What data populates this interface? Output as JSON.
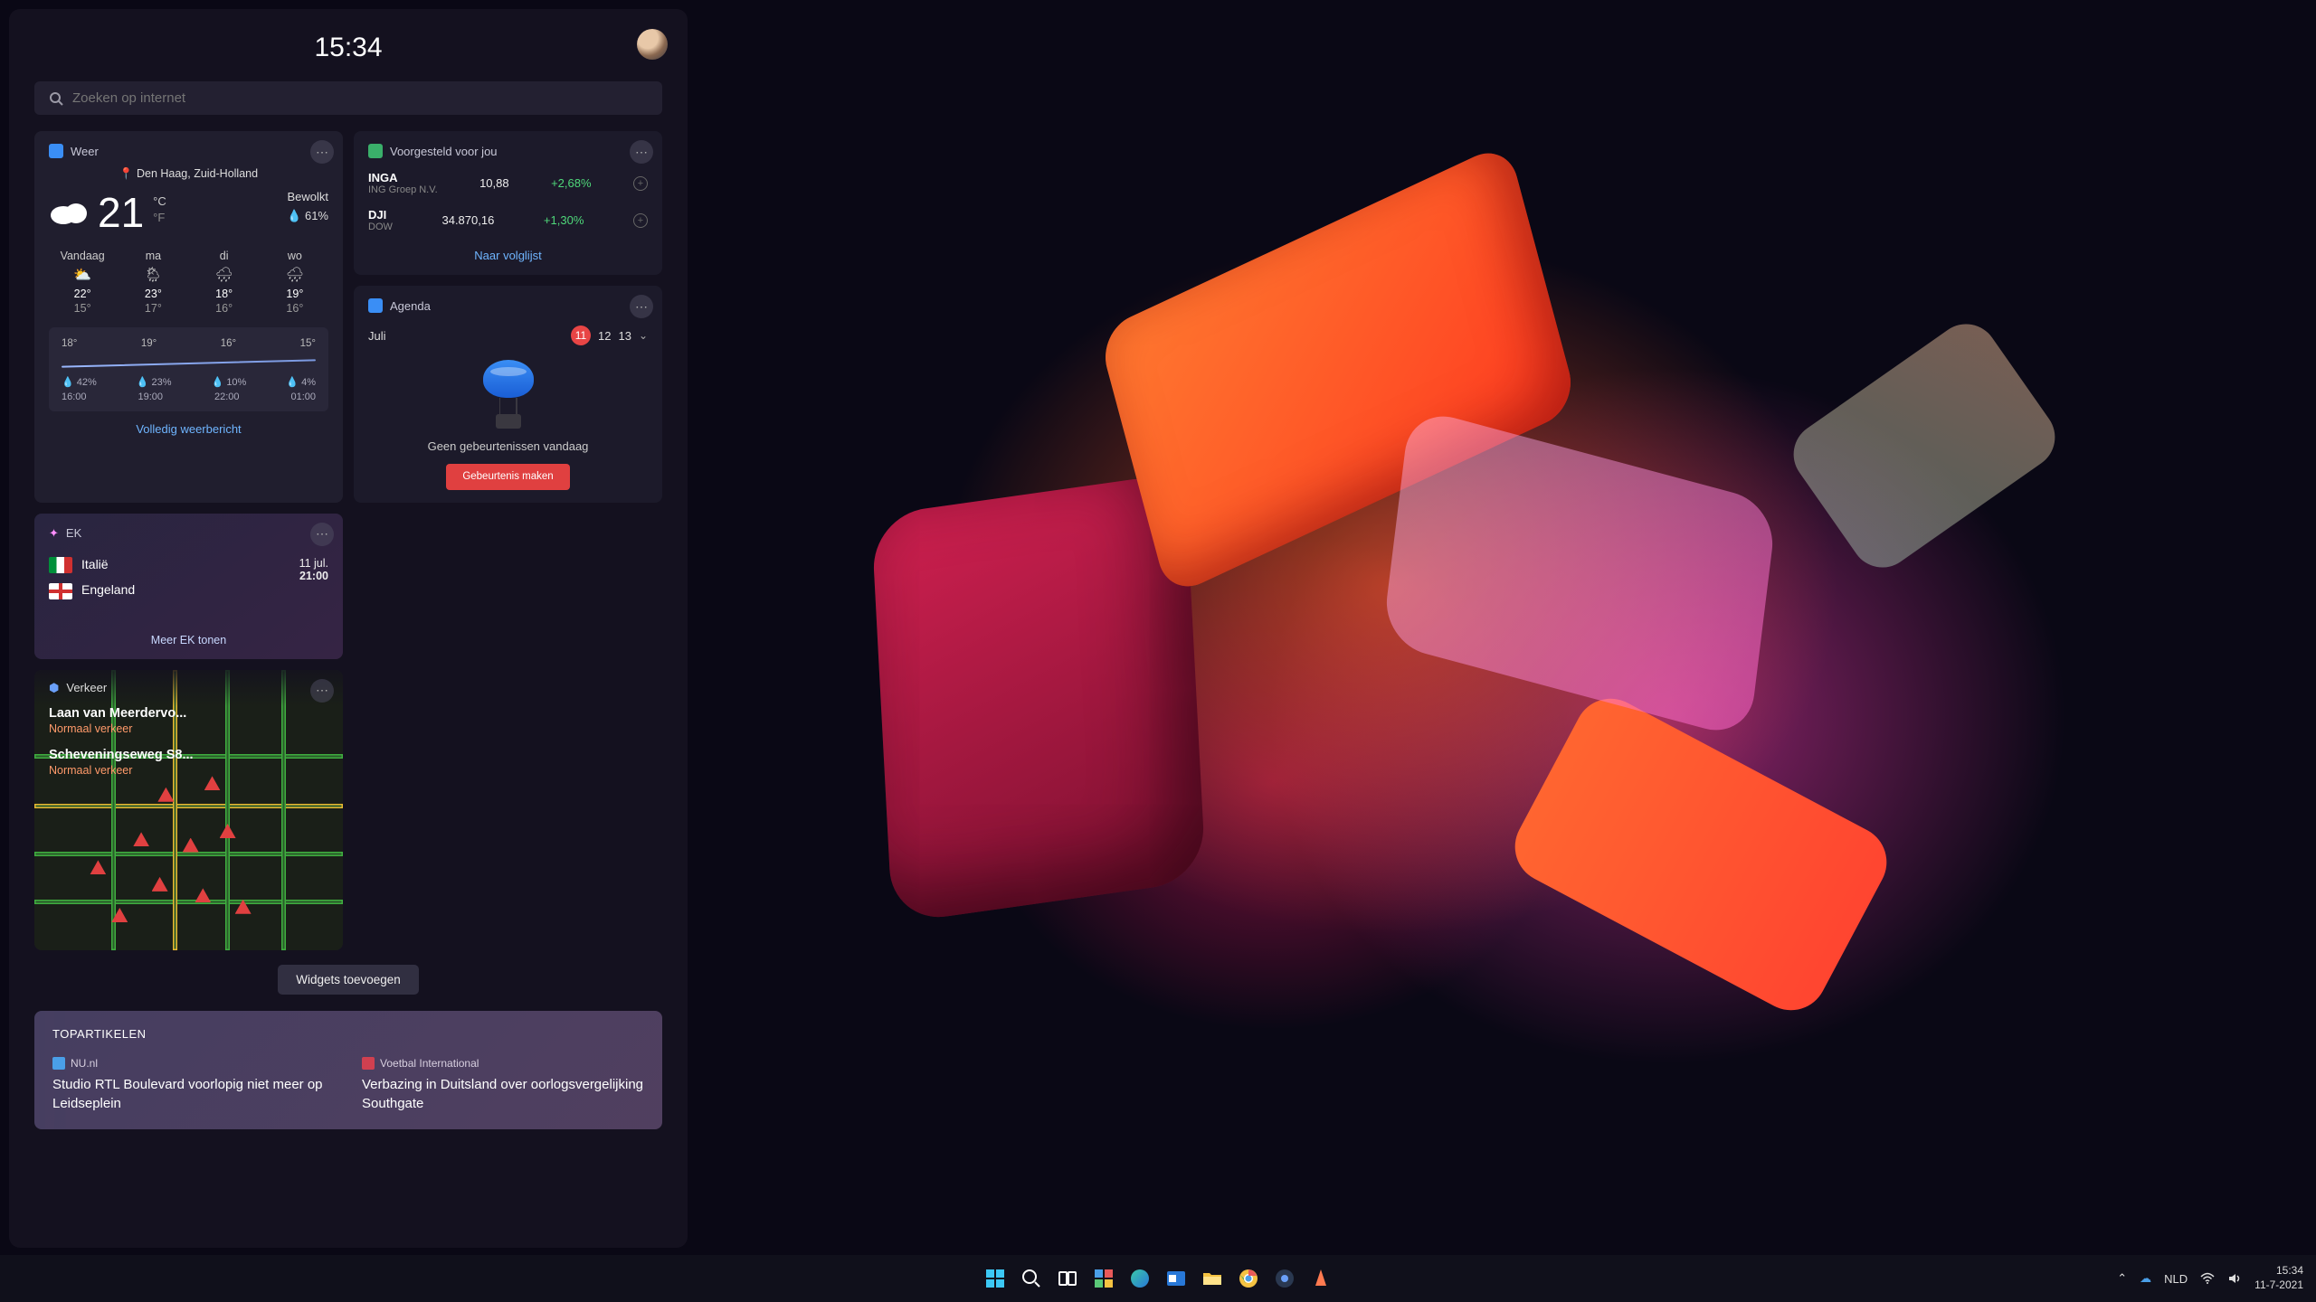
{
  "header": {
    "time": "15:34"
  },
  "search": {
    "placeholder": "Zoeken op internet"
  },
  "weather": {
    "title": "Weer",
    "location": "Den Haag, Zuid-Holland",
    "temp": "21",
    "unit_c": "°C",
    "unit_f": "°F",
    "condition": "Bewolkt",
    "rain": "61%",
    "forecast": [
      {
        "day": "Vandaag",
        "icon": "⛅",
        "hi": "22°",
        "lo": "15°"
      },
      {
        "day": "ma",
        "icon": "🌦",
        "hi": "23°",
        "lo": "17°"
      },
      {
        "day": "di",
        "icon": "🌧",
        "hi": "18°",
        "lo": "16°"
      },
      {
        "day": "wo",
        "icon": "🌧",
        "hi": "19°",
        "lo": "16°"
      }
    ],
    "chart_temps": [
      "18°",
      "19°",
      "16°",
      "15°"
    ],
    "chart_rain": [
      "42%",
      "23%",
      "10%",
      "4%"
    ],
    "chart_times": [
      "16:00",
      "19:00",
      "22:00",
      "01:00"
    ],
    "link": "Volledig weerbericht"
  },
  "stocks": {
    "title": "Voorgesteld voor jou",
    "rows": [
      {
        "sym": "INGA",
        "sub": "ING Groep N.V.",
        "price": "10,88",
        "chg": "+2,68%"
      },
      {
        "sym": "DJI",
        "sub": "DOW",
        "price": "34.870,16",
        "chg": "+1,30%"
      }
    ],
    "link": "Naar volglijst"
  },
  "agenda": {
    "title": "Agenda",
    "month": "Juli",
    "today": "11",
    "d1": "12",
    "d2": "13",
    "empty": "Geen gebeurtenissen vandaag",
    "btn": "Gebeurtenis\nmaken"
  },
  "ek": {
    "title": "EK",
    "team1": "Italië",
    "team2": "Engeland",
    "date": "11 jul.",
    "time": "21:00",
    "link": "Meer EK tonen"
  },
  "traffic": {
    "title": "Verkeer",
    "roads": [
      {
        "name": "Laan van Meerdervo...",
        "status": "Normaal verkeer"
      },
      {
        "name": "Scheveningseweg S8...",
        "status": "Normaal verkeer"
      }
    ]
  },
  "addWidgets": "Widgets toevoegen",
  "news": {
    "title": "TOPARTIKELEN",
    "items": [
      {
        "src": "NU.nl",
        "srcColor": "#4a9fe8",
        "head": "Studio RTL Boulevard voorlopig niet meer op Leidseplein"
      },
      {
        "src": "Voetbal International",
        "srcColor": "#d04050",
        "head": "Verbazing in Duitsland over oorlogsvergelijking Southgate"
      }
    ]
  },
  "tray": {
    "lang": "NLD",
    "time": "15:34",
    "date": "11-7-2021"
  }
}
